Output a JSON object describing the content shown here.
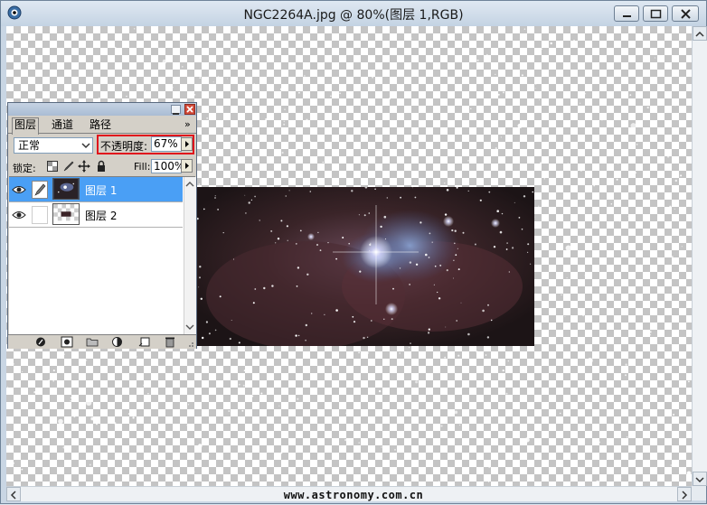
{
  "window": {
    "title": "NGC2264A.jpg @ 80%(图层 1,RGB)",
    "controls": [
      "minimize-icon",
      "maximize-icon",
      "close-icon"
    ]
  },
  "watermark": "www.astronomy.com.cn",
  "layers_palette": {
    "tabs": [
      {
        "label": "图层",
        "active": true
      },
      {
        "label": "通道",
        "active": false
      },
      {
        "label": "路径",
        "active": false
      }
    ],
    "more_label": "»",
    "blend_mode": "正常",
    "opacity_label": "不透明度:",
    "opacity_value": "67%",
    "lock_label": "锁定:",
    "fill_label": "Fill:",
    "fill_value": "100%",
    "layers": [
      {
        "name": "图层 1",
        "selected": true,
        "visible": true
      },
      {
        "name": "图层 2",
        "selected": false,
        "visible": true
      }
    ],
    "bottom_icons": [
      "link-layers-icon",
      "layer-style-icon",
      "layer-mask-icon",
      "new-group-icon",
      "adjustment-layer-icon",
      "new-layer-icon",
      "delete-layer-icon"
    ]
  },
  "colors": {
    "selection": "#4a9ff5",
    "highlight_border": "#e0141c"
  }
}
